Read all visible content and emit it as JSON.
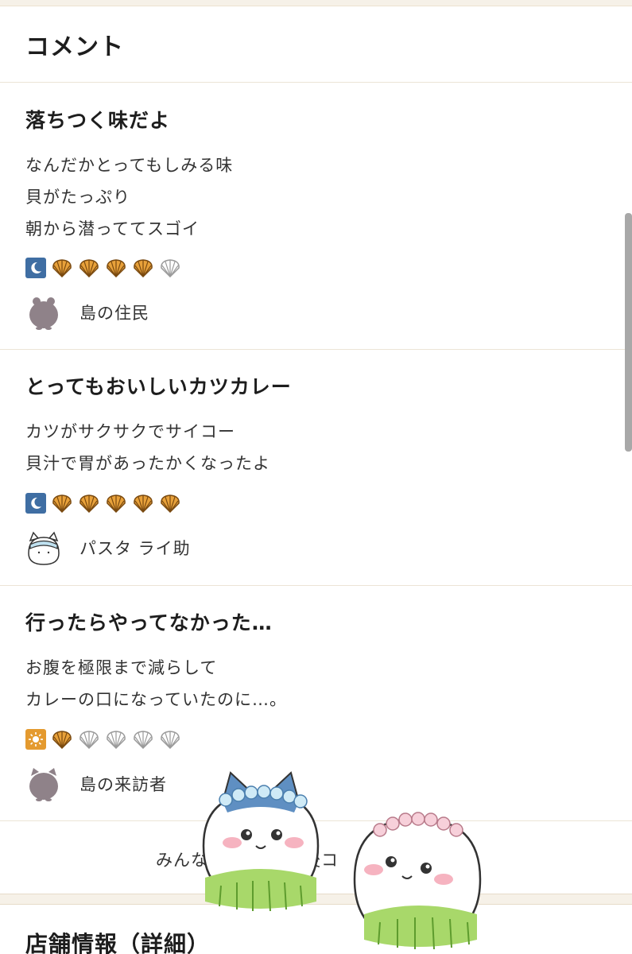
{
  "section": {
    "title": "コメント"
  },
  "comments": [
    {
      "title": "落ちつく味だよ",
      "lines": [
        "なんだかとってもしみる味",
        "貝がたっぷり",
        "朝から潜っててスゴイ"
      ],
      "time_icon": "moon-icon",
      "rating": 4,
      "max_rating": 5,
      "author": "島の住民"
    },
    {
      "title": "とってもおいしいカツカレー",
      "lines": [
        "カツがサクサクでサイコー",
        "貝汁で胃があったかくなったよ"
      ],
      "time_icon": "moon-icon",
      "rating": 5,
      "max_rating": 5,
      "author": "パスタ ライ助"
    },
    {
      "title": "行ったらやってなかった…",
      "lines": [
        "お腹を極限まで減らして",
        "カレーの口になっていたのに…。"
      ],
      "time_icon": "sun-icon",
      "rating": 1,
      "max_rating": 5,
      "author": "島の来訪者"
    }
  ],
  "more_comments": {
    "visible_left": "みんな",
    "visible_right": "後コ"
  },
  "store": {
    "title": "店舗情報（詳細）"
  },
  "colors": {
    "shell_filled": "#e8a13a",
    "shell_empty": "#cfcfcf",
    "night_badge": "#3f6ea3",
    "day_badge": "#e49a2f",
    "divider": "#ece4d6"
  }
}
